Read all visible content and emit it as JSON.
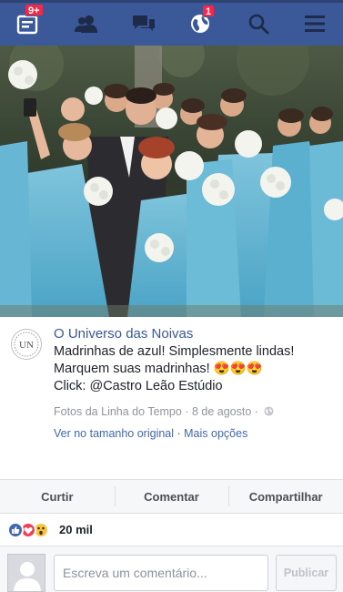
{
  "nav": {
    "friend_requests_badge": "9+",
    "notifications_badge": "1",
    "icons": [
      "feed-icon",
      "friends-icon",
      "messages-icon",
      "notifications-globe-icon",
      "search-icon",
      "menu-icon"
    ]
  },
  "post": {
    "avatar_text": "UN",
    "page_name": "O Universo das Noivas",
    "text_lines": [
      "Madrinhas de azul! Simplesmente lindas!",
      "Marquem suas madrinhas! 😍😍😍",
      "Click: @Castro Leão Estúdio"
    ],
    "meta": "Fotos da Linha do Tempo · 8 de agosto ·",
    "view_original": "Ver no tamanho original",
    "separator": " · ",
    "more_options": "Mais opções"
  },
  "actions": {
    "like": "Curtir",
    "comment": "Comentar",
    "share": "Compartilhar"
  },
  "reactions": {
    "count": "20 mil",
    "icons": [
      "like-reaction-icon",
      "love-reaction-icon",
      "wow-reaction-icon"
    ]
  },
  "composer": {
    "placeholder": "Escreva um comentário...",
    "publish": "Publicar"
  },
  "colors": {
    "brand": "#3b5998",
    "badge": "#f02849",
    "link": "#4267b2"
  }
}
